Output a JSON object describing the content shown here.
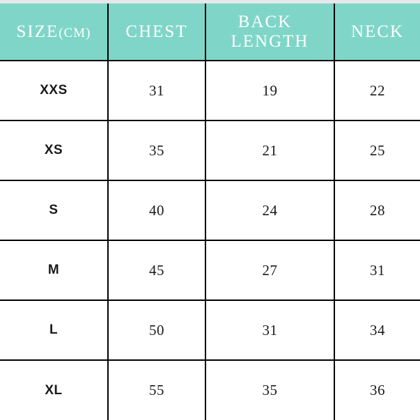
{
  "table": {
    "headers": [
      {
        "main": "SIZE",
        "sub": "(CM)"
      },
      {
        "main": "CHEST",
        "sub": ""
      },
      {
        "main": "BACK",
        "sub": "LENGTH"
      },
      {
        "main": "NECK",
        "sub": ""
      }
    ],
    "header_labels": [
      "SIZE (CM)",
      "CHEST",
      "BACK  LENGTH",
      "NECK"
    ],
    "rows": [
      {
        "size": "XXS",
        "chest": "31",
        "back_length": "19",
        "neck": "22"
      },
      {
        "size": "XS",
        "chest": "35",
        "back_length": "21",
        "neck": "25"
      },
      {
        "size": "S",
        "chest": "40",
        "back_length": "24",
        "neck": "28"
      },
      {
        "size": "M",
        "chest": "45",
        "back_length": "27",
        "neck": "31"
      },
      {
        "size": "L",
        "chest": "50",
        "back_length": "31",
        "neck": "34"
      },
      {
        "size": "XL",
        "chest": "55",
        "back_length": "35",
        "neck": "36"
      }
    ]
  },
  "chart_data": {
    "type": "table",
    "title": "",
    "categories": [
      "XXS",
      "XS",
      "S",
      "M",
      "L",
      "XL"
    ],
    "columns": [
      "SIZE (CM)",
      "CHEST",
      "BACK  LENGTH",
      "NECK"
    ],
    "series": [
      {
        "name": "CHEST",
        "values": [
          31,
          35,
          40,
          45,
          50,
          55
        ]
      },
      {
        "name": "BACK LENGTH",
        "values": [
          19,
          21,
          24,
          27,
          31,
          35
        ]
      },
      {
        "name": "NECK",
        "values": [
          22,
          25,
          28,
          31,
          34,
          36
        ]
      }
    ],
    "unit": "cm",
    "xlabel": "SIZE",
    "ylabel": "",
    "grid": true,
    "legend": "none"
  },
  "colors": {
    "header_background": "#7fd6c8",
    "header_text": "#ffffff",
    "border": "#000000",
    "body_background": "#ffffff",
    "body_text": "#1a1a1a",
    "top_strip": "#e6e8e8"
  }
}
